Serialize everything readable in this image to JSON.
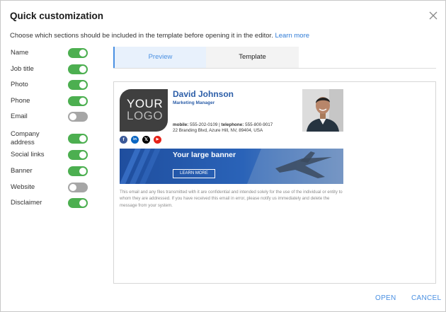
{
  "dialog": {
    "title": "Quick customization",
    "intro": "Choose which sections should be included in the template before opening it in the editor.",
    "learn_more": "Learn more",
    "close_icon": "close-icon"
  },
  "options": [
    {
      "label": "Name",
      "enabled": true
    },
    {
      "label": "Job title",
      "enabled": true
    },
    {
      "label": "Photo",
      "enabled": true
    },
    {
      "label": "Phone",
      "enabled": true
    },
    {
      "label": "Email",
      "enabled": false
    },
    {
      "label": "Company address",
      "enabled": true
    },
    {
      "label": "Social links",
      "enabled": true
    },
    {
      "label": "Banner",
      "enabled": true
    },
    {
      "label": "Website",
      "enabled": false
    },
    {
      "label": "Disclaimer",
      "enabled": true
    }
  ],
  "tabs": [
    {
      "label": "Preview",
      "active": true
    },
    {
      "label": "Template",
      "active": false
    }
  ],
  "signature": {
    "logo_line1": "YOUR",
    "logo_line2": "LOGO",
    "name": "David Johnson",
    "title": "Marketing Manager",
    "mobile_label": "mobile:",
    "mobile": "555-202-0109",
    "separator": "|",
    "telephone_label": "telephone:",
    "telephone": "555-800-9017",
    "address": "22 Branding Blvd, Azure Hill, NV, 89404, USA",
    "socials": [
      {
        "icon": "facebook-icon",
        "glyph": "f",
        "color": "#3b5998"
      },
      {
        "icon": "linkedin-icon",
        "glyph": "in",
        "color": "#0a66c2"
      },
      {
        "icon": "x-icon",
        "glyph": "𝕏",
        "color": "#000000"
      },
      {
        "icon": "youtube-icon",
        "glyph": "▶",
        "color": "#e62117"
      }
    ],
    "banner_title": "Your large banner",
    "banner_button": "LEARN MORE",
    "disclaimer": "This email and any files transmitted with it are confidential and intended solely for the use of the individual or entity to whom they are addressed. If you have received this email in error, please notify us immediately and delete the message from your system."
  },
  "footer": {
    "open": "OPEN",
    "cancel": "CANCEL"
  },
  "colors": {
    "accent": "#4a90e2",
    "toggle_on": "#4caf50",
    "toggle_off": "#a6a6a6",
    "name_blue": "#2c5ea8",
    "banner_blue": "#1f4e9e"
  }
}
